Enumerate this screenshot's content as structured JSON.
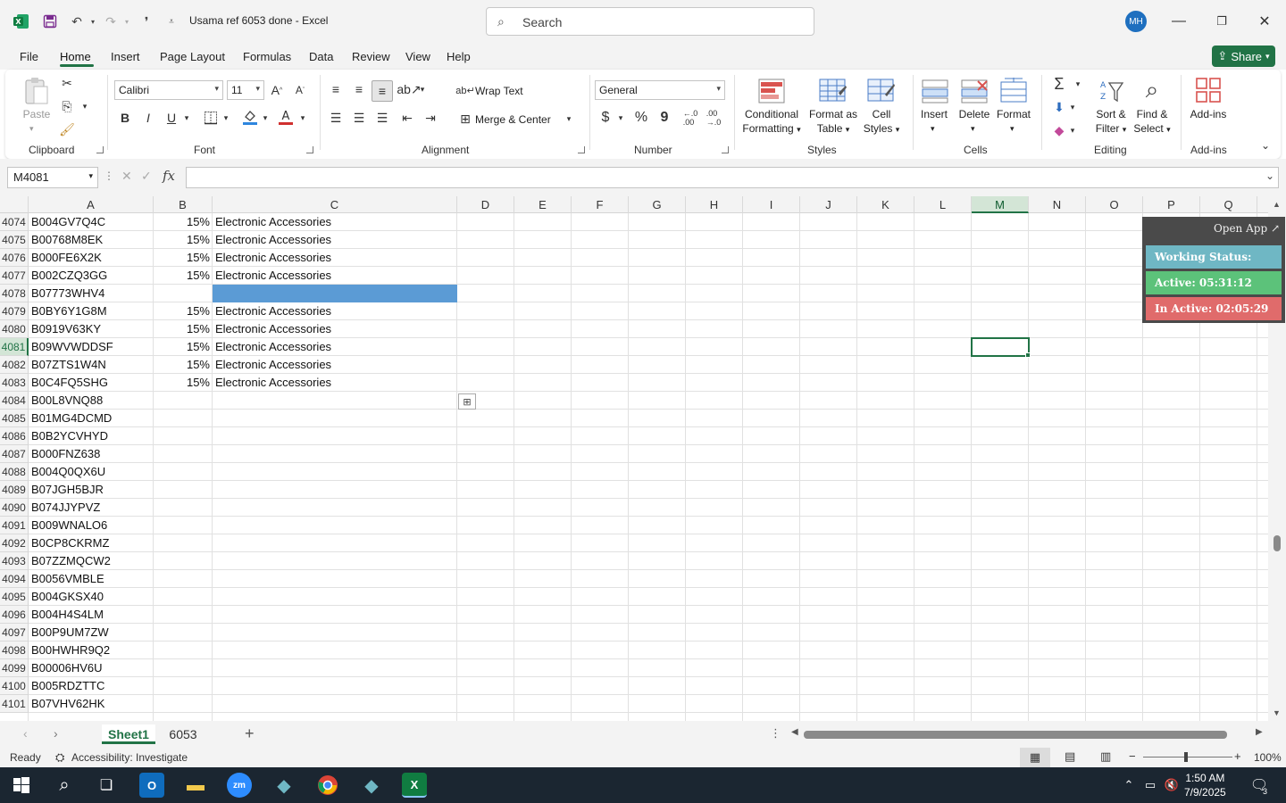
{
  "titlebar": {
    "title": "Usama ref 6053 done  -  Excel",
    "search_placeholder": "Search",
    "avatar_initials": "MH"
  },
  "menu": {
    "tabs": [
      "File",
      "Home",
      "Insert",
      "Page Layout",
      "Formulas",
      "Data",
      "Review",
      "View",
      "Help"
    ],
    "share_label": "Share"
  },
  "ribbon": {
    "clipboard": {
      "paste_label": "Paste",
      "group_label": "Clipboard"
    },
    "font": {
      "font_name": "Calibri",
      "font_size": "11",
      "group_label": "Font",
      "bold": "B",
      "italic": "I",
      "underline": "U"
    },
    "alignment": {
      "wrap_label": "Wrap Text",
      "merge_label": "Merge & Center",
      "group_label": "Alignment"
    },
    "number": {
      "format": "General",
      "group_label": "Number",
      "currency": "$",
      "percent": "%",
      "comma": "9"
    },
    "styles": {
      "conditional": [
        "Conditional",
        "Formatting"
      ],
      "format_table": [
        "Format as",
        "Table"
      ],
      "cell_styles": [
        "Cell",
        "Styles"
      ],
      "group_label": "Styles"
    },
    "cells": {
      "insert": "Insert",
      "delete": "Delete",
      "format": "Format",
      "group_label": "Cells"
    },
    "editing": {
      "sort": [
        "Sort &",
        "Filter"
      ],
      "find": [
        "Find &",
        "Select"
      ],
      "group_label": "Editing"
    },
    "addins": {
      "label": "Add-ins",
      "group_label": "Add-ins"
    }
  },
  "formula_bar": {
    "name_box": "M4081",
    "fx": "fx",
    "value": ""
  },
  "grid": {
    "columns": [
      "A",
      "B",
      "C",
      "D",
      "E",
      "F",
      "G",
      "H",
      "I",
      "J",
      "K",
      "L",
      "M",
      "N",
      "O",
      "P",
      "Q"
    ],
    "selected_column": "M",
    "selected_row": "4081",
    "rows": [
      {
        "n": "4074",
        "a": "B004GV7Q4C",
        "b": "15%",
        "c": "Electronic Accessories"
      },
      {
        "n": "4075",
        "a": "B00768M8EK",
        "b": "15%",
        "c": "Electronic Accessories"
      },
      {
        "n": "4076",
        "a": "B000FE6X2K",
        "b": "15%",
        "c": "Electronic Accessories"
      },
      {
        "n": "4077",
        "a": "B002CZQ3GG",
        "b": "15%",
        "c": "Electronic Accessories"
      },
      {
        "n": "4078",
        "a": "B07773WHV4",
        "b": "",
        "c": ""
      },
      {
        "n": "4079",
        "a": "B0BY6Y1G8M",
        "b": "15%",
        "c": "Electronic Accessories"
      },
      {
        "n": "4080",
        "a": "B0919V63KY",
        "b": "15%",
        "c": "Electronic Accessories"
      },
      {
        "n": "4081",
        "a": "B09WVWDDSF",
        "b": "15%",
        "c": "Electronic Accessories"
      },
      {
        "n": "4082",
        "a": "B07ZTS1W4N",
        "b": "15%",
        "c": "Electronic Accessories"
      },
      {
        "n": "4083",
        "a": "B0C4FQ5SHG",
        "b": "15%",
        "c": "Electronic Accessories"
      },
      {
        "n": "4084",
        "a": "B00L8VNQ88",
        "b": "",
        "c": ""
      },
      {
        "n": "4085",
        "a": "B01MG4DCMD",
        "b": "",
        "c": ""
      },
      {
        "n": "4086",
        "a": "B0B2YCVHYD",
        "b": "",
        "c": ""
      },
      {
        "n": "4087",
        "a": "B000FNZ638",
        "b": "",
        "c": ""
      },
      {
        "n": "4088",
        "a": "B004Q0QX6U",
        "b": "",
        "c": ""
      },
      {
        "n": "4089",
        "a": "B07JGH5BJR",
        "b": "",
        "c": ""
      },
      {
        "n": "4090",
        "a": "B074JJYPVZ",
        "b": "",
        "c": ""
      },
      {
        "n": "4091",
        "a": "B009WNALO6",
        "b": "",
        "c": ""
      },
      {
        "n": "4092",
        "a": "B0CP8CKRMZ",
        "b": "",
        "c": ""
      },
      {
        "n": "4093",
        "a": "B07ZZMQCW2",
        "b": "",
        "c": ""
      },
      {
        "n": "4094",
        "a": "B0056VMBLE",
        "b": "",
        "c": ""
      },
      {
        "n": "4095",
        "a": "B004GKSX40",
        "b": "",
        "c": ""
      },
      {
        "n": "4096",
        "a": "B004H4S4LM",
        "b": "",
        "c": ""
      },
      {
        "n": "4097",
        "a": "B00P9UM7ZW",
        "b": "",
        "c": ""
      },
      {
        "n": "4098",
        "a": "B00HWHR9Q2",
        "b": "",
        "c": ""
      },
      {
        "n": "4099",
        "a": "B00006HV6U",
        "b": "",
        "c": ""
      },
      {
        "n": "4100",
        "a": "B005RDZTTC",
        "b": "",
        "c": ""
      },
      {
        "n": "4101",
        "a": "B07VHV62HK",
        "b": "",
        "c": ""
      }
    ],
    "fill_color": "#5b9bd5"
  },
  "widget": {
    "open_label": "Open App ↗",
    "status": "Working Status: Active",
    "active": "Active: 05:31:12",
    "inactive": "In Active: 02:05:29",
    "colors": {
      "status": "#6fb7c4",
      "active": "#5cc27a",
      "inactive": "#e06b6b"
    }
  },
  "sheets": {
    "tabs": [
      "Sheet1",
      "6053"
    ],
    "active": "Sheet1"
  },
  "status": {
    "ready": "Ready",
    "accessibility": "Accessibility: Investigate",
    "zoom": "100%"
  },
  "taskbar": {
    "time": "1:50 AM",
    "date": "7/9/2025",
    "notif_count": "3"
  },
  "accent": "#217346"
}
